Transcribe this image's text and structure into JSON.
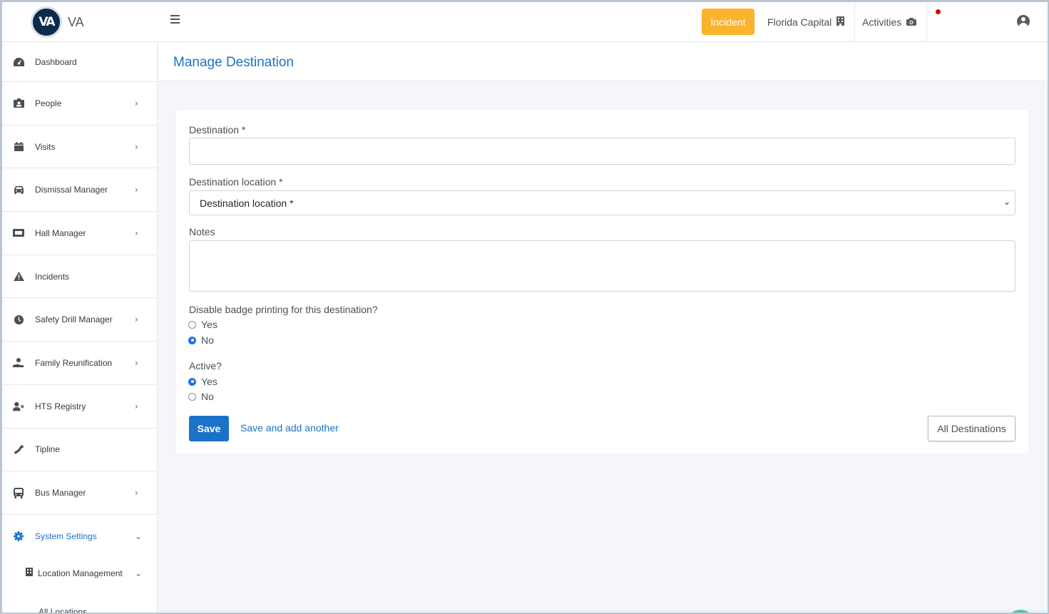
{
  "brand": {
    "logo_text": "VA",
    "name": "VA"
  },
  "topbar": {
    "incident_label": "Incident",
    "org_label": "Florida Capital",
    "activities_label": "Activities"
  },
  "sidebar": {
    "items": [
      {
        "label": "Dashboard",
        "icon": "dashboard-gauge-icon",
        "chevron": ""
      },
      {
        "label": "People",
        "icon": "id-badge-icon",
        "chevron": "›"
      },
      {
        "label": "Visits",
        "icon": "calendar-icon",
        "chevron": "›"
      },
      {
        "label": "Dismissal Manager",
        "icon": "car-icon",
        "chevron": "›"
      },
      {
        "label": "Hall Manager",
        "icon": "ticket-icon",
        "chevron": "›"
      },
      {
        "label": "Incidents",
        "icon": "warning-icon",
        "chevron": ""
      },
      {
        "label": "Safety Drill Manager",
        "icon": "clock-icon",
        "chevron": "›"
      },
      {
        "label": "Family Reunification",
        "icon": "hand-user-icon",
        "chevron": "›"
      },
      {
        "label": "HTS Registry",
        "icon": "user-x-icon",
        "chevron": "›"
      },
      {
        "label": "Tipline",
        "icon": "phone-icon",
        "chevron": ""
      },
      {
        "label": "Bus Manager",
        "icon": "bus-icon",
        "chevron": "›"
      },
      {
        "label": "System Settings",
        "icon": "gear-icon",
        "chevron": "⌄"
      }
    ],
    "sub_item": {
      "label": "Location Management",
      "icon": "building-icon",
      "chevron": "⌄"
    },
    "sub_sub_item": {
      "label": "All Locations"
    }
  },
  "page": {
    "title": "Manage Destination"
  },
  "form": {
    "destination_label": "Destination *",
    "destination_value": "",
    "location_label": "Destination location *",
    "location_selected": "Destination location *",
    "notes_label": "Notes",
    "notes_value": "",
    "badge_question": "Disable badge printing for this destination?",
    "badge_options": [
      {
        "label": "Yes",
        "checked": false
      },
      {
        "label": "No",
        "checked": true
      }
    ],
    "active_question": "Active?",
    "active_options": [
      {
        "label": "Yes",
        "checked": true
      },
      {
        "label": "No",
        "checked": false
      }
    ],
    "save_label": "Save",
    "save_add_label": "Save and add another",
    "all_destinations_label": "All Destinations"
  },
  "colors": {
    "primary": "#1a73c9",
    "incident": "#fbb32b",
    "notification_dot": "#e60000"
  }
}
